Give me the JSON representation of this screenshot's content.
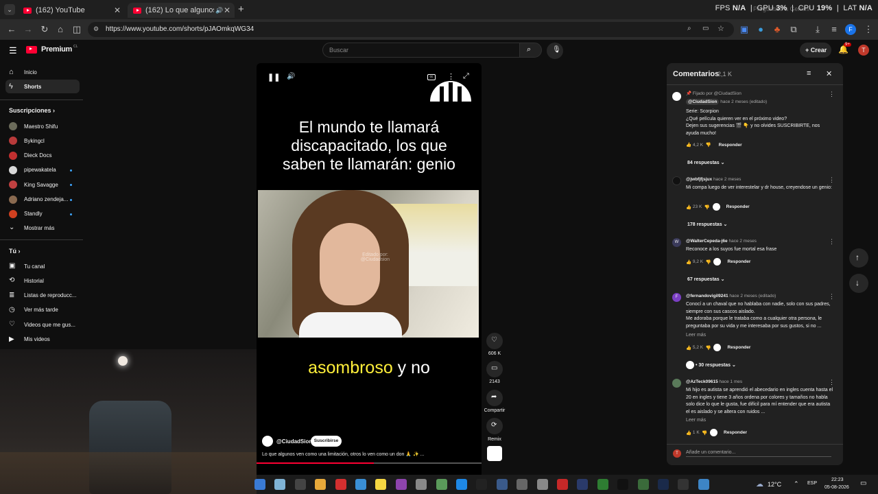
{
  "browser": {
    "tabs": [
      {
        "title": "(162) YouTube",
        "active": false
      },
      {
        "title": "(162) Lo que algunos ven c",
        "active": true
      }
    ],
    "url": "https://www.youtube.com/shorts/pJAOmkqWG34",
    "overlay": {
      "fps_label": "FPS",
      "fps_value": "N/A",
      "gpu_label": "GPU",
      "gpu_value": "3%",
      "cpu_label": "CPU",
      "cpu_value": "19%",
      "lat_label": "LAT",
      "lat_value": "N/A",
      "ghost": "Pregúntale a Gemini"
    }
  },
  "masthead": {
    "logo": "Premium",
    "logo_region": "CL",
    "search_placeholder": "Buscar",
    "create_label": "Crear",
    "notif_badge": "9+",
    "avatar_letter": "T"
  },
  "sidebar": {
    "main": [
      {
        "label": "Inicio",
        "icon": "home-icon"
      },
      {
        "label": "Shorts",
        "icon": "shorts-icon",
        "active": true
      }
    ],
    "subs_title": "Suscripciones",
    "subs": [
      {
        "label": "Maestro Shifu",
        "color": "#6b6b5a",
        "live": false
      },
      {
        "label": "Bykingcl",
        "color": "#b83a3a",
        "live": false
      },
      {
        "label": "Dieck Docs",
        "color": "#c23030",
        "live": false
      },
      {
        "label": "pipewakatela",
        "color": "#d8d8d8",
        "live": true
      },
      {
        "label": "King Savagge",
        "color": "#c04040",
        "live": true
      },
      {
        "label": "Adriano zendeja...",
        "color": "#8a6a50",
        "live": true
      },
      {
        "label": "Standly",
        "color": "#d04020",
        "live": true
      }
    ],
    "show_more": "Mostrar más",
    "you_title": "Tú",
    "you": [
      {
        "label": "Tu canal",
        "icon": "channel-icon"
      },
      {
        "label": "Historial",
        "icon": "history-icon"
      },
      {
        "label": "Listas de reproducc...",
        "icon": "playlists-icon"
      },
      {
        "label": "Ver más tarde",
        "icon": "watch-later-icon"
      },
      {
        "label": "Videos que me gus...",
        "icon": "like-icon"
      },
      {
        "label": "Mis videos",
        "icon": "my-videos-icon"
      }
    ]
  },
  "video": {
    "caption_top": "El mundo te llamará discapacitado, los que saben te llamarán: genio",
    "caption_bottom_hl": "asombroso",
    "caption_bottom_rest": " y no",
    "watermark": "Editado por: @Ciudadsion",
    "channel": "@CiudadSion",
    "subscribe": "Suscribirse",
    "description": "Lo que algunos ven como una limitación, otros lo ven como un don 🙏 ✨ ...",
    "progress": 0.52
  },
  "actions": {
    "likes": "606 K",
    "comments": "2143",
    "share": "Compartir",
    "remix": "Remix"
  },
  "comments": {
    "title": "Comentarios",
    "count": "2,1 K",
    "add_placeholder": "Añade un comentario...",
    "add_avatar": "T",
    "items": [
      {
        "pinned": "Fijado por @CiudadSion",
        "author": "@CiudadSion",
        "time": "hace 2 meses (editado)",
        "lines": [
          "Serie: Scorpion",
          "¿Qué película quieren ver en el próximo video?",
          "Dejen sus sugerencias 🎬 👇 y no olvides SUSCRIBIRTE, nos ayuda mucho!"
        ],
        "likes": "4,2 K",
        "reply": "Responder",
        "replies": "84 respuestas",
        "avatar_color": "#ffffff"
      },
      {
        "author": "@jwbfjfjsjux",
        "time": "hace 2 meses",
        "lines": [
          "Mi compa luego de ver interestelar y dr house, creyendose un genio:"
        ],
        "likes": "23 K",
        "reply": "Responder",
        "replies": "178 respuestas",
        "avatar_color": "#111111"
      },
      {
        "author": "@WalterCepeda-j6e",
        "time": "hace 2 meses",
        "lines": [
          "Reconoce a los suyos fue mortal esa frase"
        ],
        "likes": "9,2 K",
        "reply": "Responder",
        "replies": "67 respuestas",
        "avatar_color": "#3a3a5a",
        "avatar_letter": "W"
      },
      {
        "author": "@fernandovigil9241",
        "time": "hace 2 meses (editado)",
        "lines": [
          "Conocí a un chaval que no hablaba con nadie, solo con sus padres, siempre con sus cascos aislado.",
          "Me adoraba porque le trataba como a cualquier otra persona, le preguntaba por su vida y me interesaba por sus gustos, si no ..."
        ],
        "more": "Leer más",
        "likes": "5,2 K",
        "reply": "Responder",
        "replies": "• 30 respuestas",
        "avatar_color": "#7b3fc4",
        "avatar_letter": "F"
      },
      {
        "author": "@AzTeck09615",
        "time": "hace 1 mes",
        "lines": [
          "Mi hijo es autista se aprendió el abecedario en ingles cuenta hasta el 20 en ingles y tiene 3 años ordena por colores y tamaños no habla solo dice lo que le gusta, fue difícil para mí entender que era autista el es aislado y se altera con ruidos ..."
        ],
        "more": "Leer más",
        "likes": "1 K",
        "reply": "Responder",
        "avatar_color": "#5a7a5a"
      }
    ]
  },
  "taskbar": {
    "weather": "12°C",
    "lang": "ESP",
    "time": "22:23",
    "date": "05-08-2026"
  }
}
